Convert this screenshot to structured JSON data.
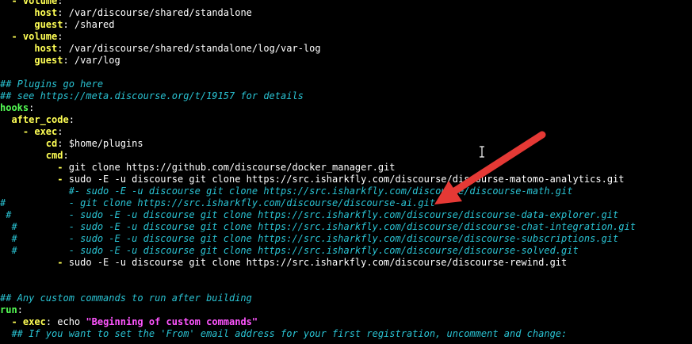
{
  "colors": {
    "background": "#000000",
    "text": "#ffffff",
    "key": "#ffff55",
    "comment": "#2ac3d3",
    "section": "#55ff55",
    "string": "#ff55ff",
    "arrow": "#e53935"
  },
  "lines": [
    {
      "parts": [
        {
          "t": "  - ",
          "c": "k-yellow"
        },
        {
          "t": "volume",
          "c": "k-yellow"
        },
        {
          "t": ":",
          "c": "k-white"
        }
      ]
    },
    {
      "parts": [
        {
          "t": "      ",
          "c": "k-white"
        },
        {
          "t": "host",
          "c": "k-yellow"
        },
        {
          "t": ": /var/discourse/shared/standalone",
          "c": "k-white"
        }
      ]
    },
    {
      "parts": [
        {
          "t": "      ",
          "c": "k-white"
        },
        {
          "t": "guest",
          "c": "k-yellow"
        },
        {
          "t": ": /shared",
          "c": "k-white"
        }
      ]
    },
    {
      "parts": [
        {
          "t": "  - ",
          "c": "k-yellow"
        },
        {
          "t": "volume",
          "c": "k-yellow"
        },
        {
          "t": ":",
          "c": "k-white"
        }
      ]
    },
    {
      "parts": [
        {
          "t": "      ",
          "c": "k-white"
        },
        {
          "t": "host",
          "c": "k-yellow"
        },
        {
          "t": ": /var/discourse/shared/standalone/log/var-log",
          "c": "k-white"
        }
      ]
    },
    {
      "parts": [
        {
          "t": "      ",
          "c": "k-white"
        },
        {
          "t": "guest",
          "c": "k-yellow"
        },
        {
          "t": ": /var/log",
          "c": "k-white"
        }
      ]
    },
    {
      "parts": [
        {
          "t": "",
          "c": "k-white"
        }
      ]
    },
    {
      "parts": [
        {
          "t": "## Plugins go here",
          "c": "k-cyan"
        }
      ]
    },
    {
      "parts": [
        {
          "t": "## see https://meta.discourse.org/t/19157 for details",
          "c": "k-cyan"
        }
      ]
    },
    {
      "parts": [
        {
          "t": "hooks",
          "c": "k-green"
        },
        {
          "t": ":",
          "c": "k-white"
        }
      ]
    },
    {
      "parts": [
        {
          "t": "  ",
          "c": "k-white"
        },
        {
          "t": "after_code",
          "c": "k-yellow"
        },
        {
          "t": ":",
          "c": "k-white"
        }
      ]
    },
    {
      "parts": [
        {
          "t": "    - ",
          "c": "k-yellow"
        },
        {
          "t": "exec",
          "c": "k-yellow"
        },
        {
          "t": ":",
          "c": "k-white"
        }
      ]
    },
    {
      "parts": [
        {
          "t": "        ",
          "c": "k-white"
        },
        {
          "t": "cd",
          "c": "k-yellow"
        },
        {
          "t": ": $home/plugins",
          "c": "k-white"
        }
      ]
    },
    {
      "parts": [
        {
          "t": "        ",
          "c": "k-white"
        },
        {
          "t": "cmd",
          "c": "k-yellow"
        },
        {
          "t": ":",
          "c": "k-white"
        }
      ]
    },
    {
      "parts": [
        {
          "t": "          - ",
          "c": "k-yellow"
        },
        {
          "t": "git clone https://github.com/discourse/docker_manager.git",
          "c": "k-white"
        }
      ]
    },
    {
      "parts": [
        {
          "t": "          - ",
          "c": "k-yellow"
        },
        {
          "t": "sudo -E -u discourse git clone https://src.isharkfly.com/discourse/discourse-matomo-analytics.git",
          "c": "k-white"
        }
      ]
    },
    {
      "parts": [
        {
          "t": "            #- sudo -E -u discourse git clone https://src.isharkfly.com/discourse/discourse-math.git",
          "c": "k-cyan"
        }
      ]
    },
    {
      "parts": [
        {
          "t": "#           - git clone https://src.isharkfly.com/discourse/discourse-ai.git",
          "c": "k-cyan"
        }
      ]
    },
    {
      "parts": [
        {
          "t": " #          - sudo -E -u discourse git clone https://src.isharkfly.com/discourse/discourse-data-explorer.git",
          "c": "k-cyan"
        }
      ]
    },
    {
      "parts": [
        {
          "t": "  #         - sudo -E -u discourse git clone https://src.isharkfly.com/discourse/discourse-chat-integration.git",
          "c": "k-cyan"
        }
      ]
    },
    {
      "parts": [
        {
          "t": "  #         - sudo -E -u discourse git clone https://src.isharkfly.com/discourse/discourse-subscriptions.git",
          "c": "k-cyan"
        }
      ]
    },
    {
      "parts": [
        {
          "t": "  #         - sudo -E -u discourse git clone https://src.isharkfly.com/discourse/discourse-solved.git",
          "c": "k-cyan"
        }
      ]
    },
    {
      "parts": [
        {
          "t": "          - ",
          "c": "k-yellow"
        },
        {
          "t": "sudo -E -u discourse git clone https://src.isharkfly.com/discourse/discourse-rewind.git",
          "c": "k-white"
        }
      ]
    },
    {
      "parts": [
        {
          "t": "",
          "c": "k-white"
        }
      ]
    },
    {
      "parts": [
        {
          "t": "",
          "c": "k-white"
        }
      ]
    },
    {
      "parts": [
        {
          "t": "## Any custom commands to run after building",
          "c": "k-cyan"
        }
      ]
    },
    {
      "parts": [
        {
          "t": "run",
          "c": "k-green"
        },
        {
          "t": ":",
          "c": "k-white"
        }
      ]
    },
    {
      "parts": [
        {
          "t": "  - ",
          "c": "k-yellow"
        },
        {
          "t": "exec",
          "c": "k-yellow"
        },
        {
          "t": ": echo ",
          "c": "k-white"
        },
        {
          "t": "\"Beginning of custom commands\"",
          "c": "k-magenta"
        }
      ]
    },
    {
      "parts": [
        {
          "t": "  ## If you want to set the 'From' email address for your first registration, uncomment and change:",
          "c": "k-cyan"
        }
      ]
    }
  ]
}
